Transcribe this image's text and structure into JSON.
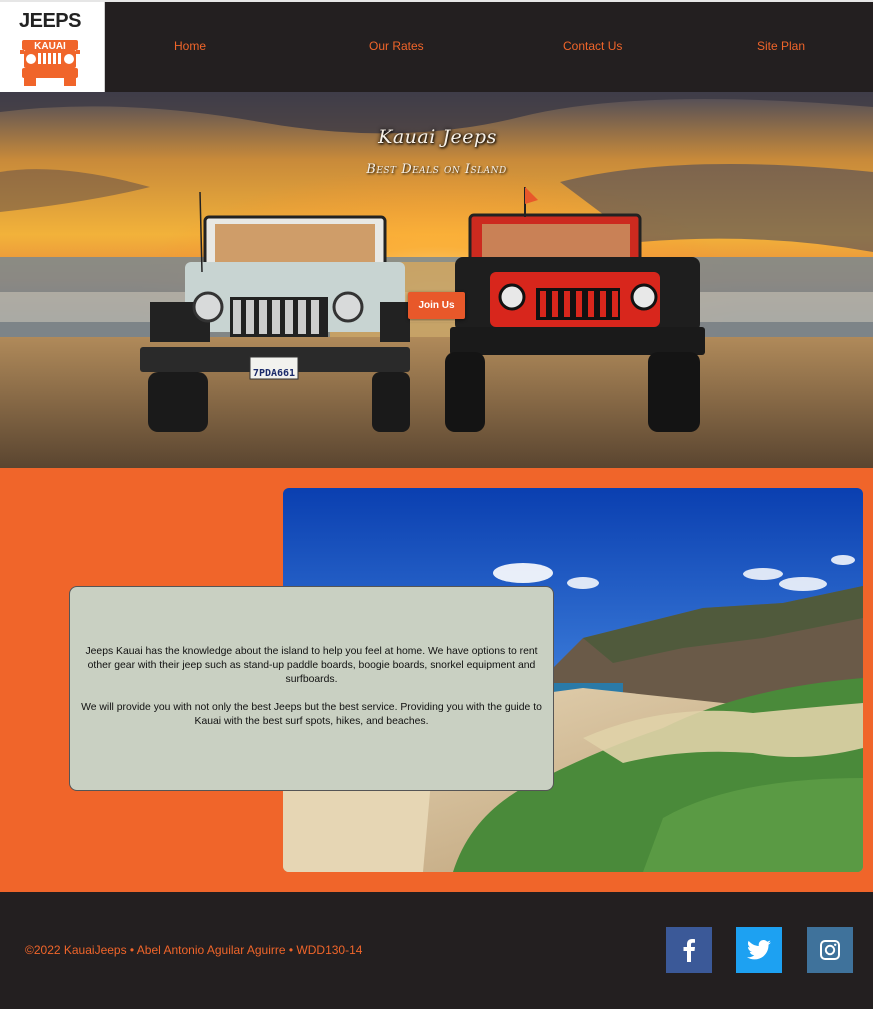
{
  "header": {
    "logo_top": "JEEPS",
    "logo_bottom": "KAUAI",
    "nav": [
      "Home",
      "Our Rates",
      "Contact Us",
      "Site Plan"
    ]
  },
  "hero": {
    "title": "Kauai Jeeps",
    "subtitle": "Best Deals on Island",
    "button_label": "Join Us",
    "plate": "7PDA661",
    "plate_state": "California"
  },
  "about": {
    "paragraphs": [
      "Jeeps Kauai has the knowledge about the island to help you feel at home. We have options to rent other gear with their jeep such as stand-up paddle boards, boogie boards, snorkel equipment and surfboards.",
      "We will provide you with not only the best Jeeps but the best service. Providing you with the guide to Kauai with the best surf spots, hikes, and beaches."
    ]
  },
  "footer": {
    "copyright": "©2022 KauaiJeeps • Abel Antonio Aguilar Aguirre • WDD130-14",
    "social": [
      {
        "name": "facebook-icon",
        "color": "#3b5998"
      },
      {
        "name": "twitter-icon",
        "color": "#1da1f2"
      },
      {
        "name": "instagram-icon",
        "color": "#3f729b"
      }
    ]
  },
  "colors": {
    "accent": "#f0652a",
    "dark": "#231f20",
    "panel": "#c9d0c2"
  }
}
